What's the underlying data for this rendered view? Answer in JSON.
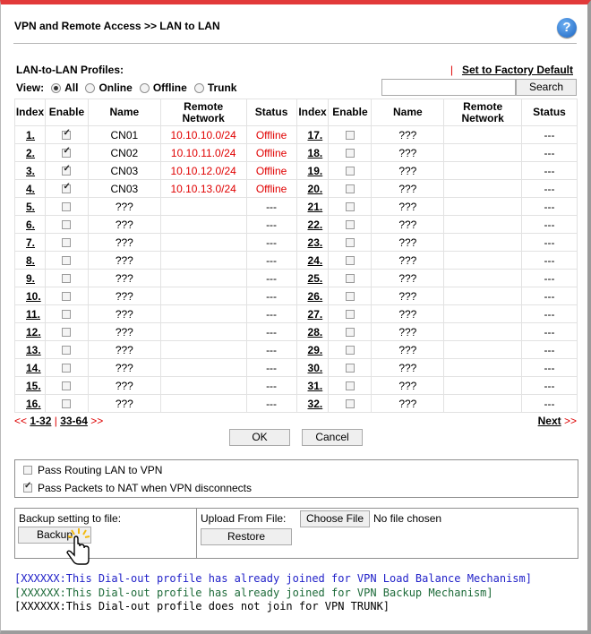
{
  "header": {
    "title": "VPN and Remote Access >> LAN to LAN",
    "help_icon": "?"
  },
  "profiles_label": "LAN-to-LAN Profiles:",
  "factory": {
    "separator": "|",
    "label": "Set to Factory Default"
  },
  "view": {
    "label": "View:",
    "options": [
      "All",
      "Online",
      "Offline",
      "Trunk"
    ],
    "selected": "All"
  },
  "search": {
    "value": "",
    "button_label": "Search"
  },
  "table": {
    "headers": {
      "index": "Index",
      "enable": "Enable",
      "name": "Name",
      "remote_line1": "Remote",
      "remote_line2": "Network",
      "status": "Status"
    },
    "left_rows": [
      {
        "index": "1.",
        "enabled": true,
        "name": "CN01",
        "remote": "10.10.10.0/24",
        "status": "Offline"
      },
      {
        "index": "2.",
        "enabled": true,
        "name": "CN02",
        "remote": "10.10.11.0/24",
        "status": "Offline"
      },
      {
        "index": "3.",
        "enabled": true,
        "name": "CN03",
        "remote": "10.10.12.0/24",
        "status": "Offline"
      },
      {
        "index": "4.",
        "enabled": true,
        "name": "CN03",
        "remote": "10.10.13.0/24",
        "status": "Offline"
      },
      {
        "index": "5.",
        "enabled": false,
        "name": "???",
        "remote": "",
        "status": "---"
      },
      {
        "index": "6.",
        "enabled": false,
        "name": "???",
        "remote": "",
        "status": "---"
      },
      {
        "index": "7.",
        "enabled": false,
        "name": "???",
        "remote": "",
        "status": "---"
      },
      {
        "index": "8.",
        "enabled": false,
        "name": "???",
        "remote": "",
        "status": "---"
      },
      {
        "index": "9.",
        "enabled": false,
        "name": "???",
        "remote": "",
        "status": "---"
      },
      {
        "index": "10.",
        "enabled": false,
        "name": "???",
        "remote": "",
        "status": "---"
      },
      {
        "index": "11.",
        "enabled": false,
        "name": "???",
        "remote": "",
        "status": "---"
      },
      {
        "index": "12.",
        "enabled": false,
        "name": "???",
        "remote": "",
        "status": "---"
      },
      {
        "index": "13.",
        "enabled": false,
        "name": "???",
        "remote": "",
        "status": "---"
      },
      {
        "index": "14.",
        "enabled": false,
        "name": "???",
        "remote": "",
        "status": "---"
      },
      {
        "index": "15.",
        "enabled": false,
        "name": "???",
        "remote": "",
        "status": "---"
      },
      {
        "index": "16.",
        "enabled": false,
        "name": "???",
        "remote": "",
        "status": "---"
      }
    ],
    "right_rows": [
      {
        "index": "17.",
        "enabled": false,
        "name": "???",
        "remote": "",
        "status": "---"
      },
      {
        "index": "18.",
        "enabled": false,
        "name": "???",
        "remote": "",
        "status": "---"
      },
      {
        "index": "19.",
        "enabled": false,
        "name": "???",
        "remote": "",
        "status": "---"
      },
      {
        "index": "20.",
        "enabled": false,
        "name": "???",
        "remote": "",
        "status": "---"
      },
      {
        "index": "21.",
        "enabled": false,
        "name": "???",
        "remote": "",
        "status": "---"
      },
      {
        "index": "22.",
        "enabled": false,
        "name": "???",
        "remote": "",
        "status": "---"
      },
      {
        "index": "23.",
        "enabled": false,
        "name": "???",
        "remote": "",
        "status": "---"
      },
      {
        "index": "24.",
        "enabled": false,
        "name": "???",
        "remote": "",
        "status": "---"
      },
      {
        "index": "25.",
        "enabled": false,
        "name": "???",
        "remote": "",
        "status": "---"
      },
      {
        "index": "26.",
        "enabled": false,
        "name": "???",
        "remote": "",
        "status": "---"
      },
      {
        "index": "27.",
        "enabled": false,
        "name": "???",
        "remote": "",
        "status": "---"
      },
      {
        "index": "28.",
        "enabled": false,
        "name": "???",
        "remote": "",
        "status": "---"
      },
      {
        "index": "29.",
        "enabled": false,
        "name": "???",
        "remote": "",
        "status": "---"
      },
      {
        "index": "30.",
        "enabled": false,
        "name": "???",
        "remote": "",
        "status": "---"
      },
      {
        "index": "31.",
        "enabled": false,
        "name": "???",
        "remote": "",
        "status": "---"
      },
      {
        "index": "32.",
        "enabled": false,
        "name": "???",
        "remote": "",
        "status": "---"
      }
    ]
  },
  "pager": {
    "prev_arrows": "<<",
    "page1": "1-32",
    "separator": "|",
    "page2": "33-64",
    "after_arrows": ">>",
    "next_label": "Next",
    "next_arrows": ">>"
  },
  "actions": {
    "ok": "OK",
    "cancel": "Cancel"
  },
  "options": [
    {
      "label": "Pass Routing LAN to VPN",
      "checked": false
    },
    {
      "label": "Pass Packets to NAT when VPN disconnects",
      "checked": true
    }
  ],
  "backup": {
    "label": "Backup setting to file:",
    "button": "Backup"
  },
  "upload": {
    "label": "Upload From File:",
    "choose_button": "Choose File",
    "file_status": "No file chosen",
    "restore_button": "Restore"
  },
  "messages": [
    {
      "text": "[XXXXXX:This Dial-out profile has already joined for VPN Load Balance Mechanism]",
      "color": "#1f1fc8"
    },
    {
      "text": "[XXXXXX:This Dial-out profile has already joined for VPN Backup Mechanism]",
      "color": "#1e6b3a"
    },
    {
      "text": "[XXXXXX:This Dial-out profile does not join for VPN TRUNK]",
      "color": "#000000"
    }
  ],
  "colors": {
    "accent_red": "#e23a3a",
    "status_red": "#e00000"
  }
}
